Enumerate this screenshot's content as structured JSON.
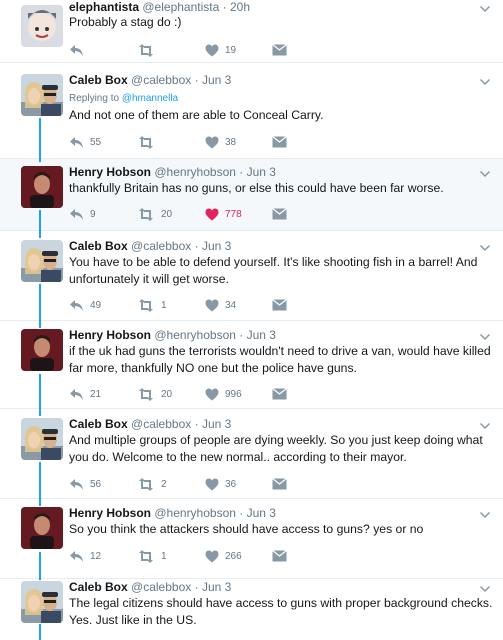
{
  "tweets": [
    {
      "name": "elephantista",
      "handle": "@elephantista",
      "date": "20h",
      "reply_to": "",
      "text": "Probably a stag do :)",
      "reply_count": "",
      "retweet_count": "",
      "like_count": "19",
      "liked": false
    },
    {
      "name": "Caleb Box",
      "handle": "@calebbox",
      "date": "Jun 3",
      "reply_to": "@hmannella",
      "text": "And not one of them are able to Conceal Carry.",
      "reply_count": "55",
      "retweet_count": "",
      "like_count": "38",
      "liked": false
    },
    {
      "name": "Henry Hobson",
      "handle": "@henryhobson",
      "date": "Jun 3",
      "reply_to": "",
      "text": "thankfully Britain has no guns, or else this could have been far worse.",
      "reply_count": "9",
      "retweet_count": "20",
      "like_count": "778",
      "liked": true
    },
    {
      "name": "Caleb Box",
      "handle": "@calebbox",
      "date": "Jun 3",
      "reply_to": "",
      "text": "You have to be able to defend yourself. It's like shooting fish in a barrel! And unfortunately it will get worse.",
      "reply_count": "49",
      "retweet_count": "1",
      "like_count": "34",
      "liked": false
    },
    {
      "name": "Henry Hobson",
      "handle": "@henryhobson",
      "date": "Jun 3",
      "reply_to": "",
      "text": "if the uk had guns the terrorists wouldn't need to drive a van, would have killed far more, thankfully  NO one but the police have guns.",
      "reply_count": "21",
      "retweet_count": "20",
      "like_count": "996",
      "liked": false
    },
    {
      "name": "Caleb Box",
      "handle": "@calebbox",
      "date": "Jun 3",
      "reply_to": "",
      "text": "And multiple groups of people are dying weekly. So you just keep doing what you do. Welcome to the new normal.. according to their mayor.",
      "reply_count": "56",
      "retweet_count": "2",
      "like_count": "36",
      "liked": false
    },
    {
      "name": "Henry Hobson",
      "handle": "@henryhobson",
      "date": "Jun 3",
      "reply_to": "",
      "text": "So you think the attackers should have access to guns? yes or no",
      "reply_count": "12",
      "retweet_count": "1",
      "like_count": "266",
      "liked": false
    },
    {
      "name": "Caleb Box",
      "handle": "@calebbox",
      "date": "Jun 3",
      "reply_to": "",
      "text": "The legal citizens should have access to guns with proper background checks. Yes. Just like in the US.",
      "reply_count": "",
      "retweet_count": "",
      "like_count": "",
      "liked": false
    }
  ],
  "labels": {
    "replying_to": "Replying to",
    "separator": "·"
  },
  "colors": {
    "accent": "#1da1f2",
    "like_active": "#e0245e",
    "icon": "#8899a6",
    "text_secondary": "#657786"
  },
  "icons": {
    "reply": "reply-icon",
    "retweet": "retweet-icon",
    "like": "heart-icon",
    "dm": "envelope-icon",
    "more": "chevron-down-icon"
  }
}
